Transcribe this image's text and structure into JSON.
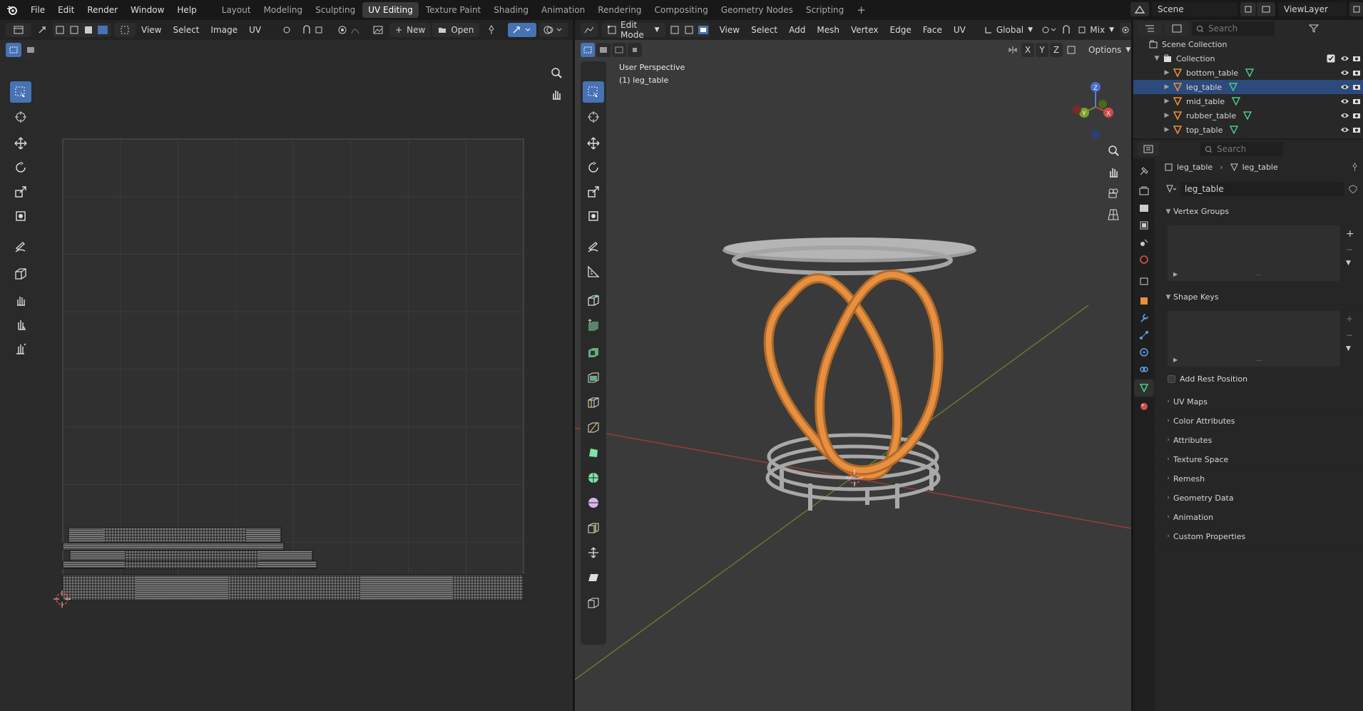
{
  "topbar": {
    "menus": [
      "File",
      "Edit",
      "Render",
      "Window",
      "Help"
    ],
    "workspaces": [
      "Layout",
      "Modeling",
      "Sculpting",
      "UV Editing",
      "Texture Paint",
      "Shading",
      "Animation",
      "Rendering",
      "Compositing",
      "Geometry Nodes",
      "Scripting"
    ],
    "active_workspace": "UV Editing",
    "scene": "Scene",
    "view_layer": "ViewLayer"
  },
  "uv_editor": {
    "menus": [
      "View",
      "Select",
      "Image",
      "UV"
    ],
    "new_label": "New",
    "open_label": "Open"
  },
  "viewport": {
    "mode": "Edit Mode",
    "menus": [
      "View",
      "Select",
      "Add",
      "Mesh",
      "Vertex",
      "Edge",
      "Face",
      "UV"
    ],
    "transform_orientation": "Global",
    "snap_mode": "Mix",
    "axes": [
      "X",
      "Y",
      "Z"
    ],
    "options_label": "Options",
    "overlay_line1": "User Perspective",
    "overlay_line2": "(1) leg_table",
    "gizmo_labels": [
      "Z",
      "Y",
      "X"
    ]
  },
  "outliner": {
    "search_placeholder": "Search",
    "scene_collection": "Scene Collection",
    "collection": "Collection",
    "objects": [
      {
        "name": "bottom_table",
        "selected": false
      },
      {
        "name": "leg_table",
        "selected": true
      },
      {
        "name": "mid_table",
        "selected": false
      },
      {
        "name": "rubber_table",
        "selected": false
      },
      {
        "name": "top_table",
        "selected": false
      }
    ]
  },
  "properties": {
    "search_placeholder": "Search",
    "breadcrumb_object": "leg_table",
    "breadcrumb_data": "leg_table",
    "data_name": "leg_table",
    "vertex_groups": "Vertex Groups",
    "shape_keys": "Shape Keys",
    "add_rest_position": "Add Rest Position",
    "sections": [
      "UV Maps",
      "Color Attributes",
      "Attributes",
      "Texture Space",
      "Remesh",
      "Geometry Data",
      "Animation",
      "Custom Properties"
    ]
  },
  "colors": {
    "accent": "#4772b3",
    "selection_orange": "#e89040",
    "mesh_gray": "#a8a8a8",
    "axis_red": "#b23a3a",
    "axis_green": "#6a8a2a"
  }
}
